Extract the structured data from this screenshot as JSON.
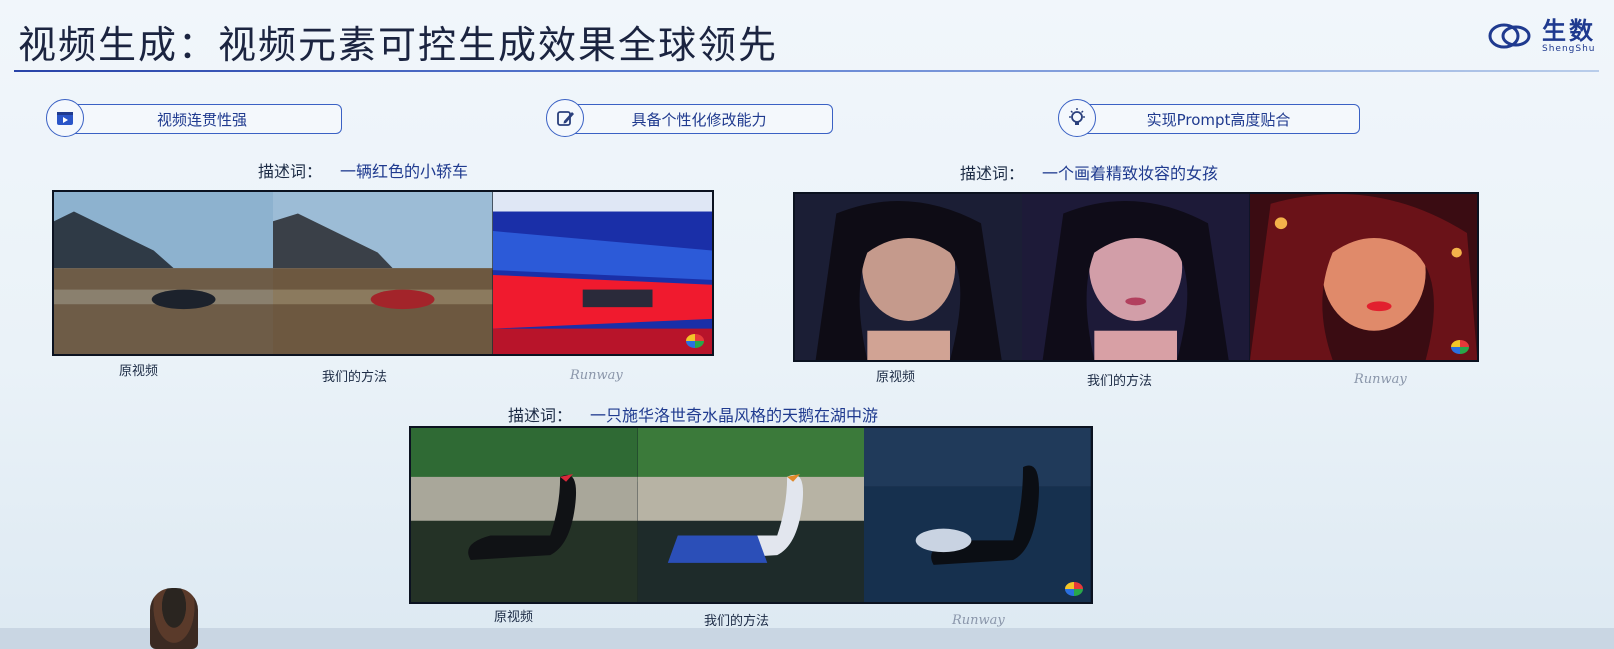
{
  "slide": {
    "title": "视频生成：视频元素可控生成效果全球领先",
    "logo_cn": "生数",
    "logo_en": "ShengShu"
  },
  "features": [
    {
      "label": "视频连贯性强",
      "icon": "video-player-icon"
    },
    {
      "label": "具备个性化修改能力",
      "icon": "edit-pencil-icon"
    },
    {
      "label": "实现Prompt高度贴合",
      "icon": "lightbulb-icon"
    }
  ],
  "groups": [
    {
      "prompt_label": "描述词：",
      "prompt_text": "一辆红色的小轿车",
      "captions": [
        "原视频",
        "我们的方法",
        "Runway"
      ]
    },
    {
      "prompt_label": "描述词：",
      "prompt_text": "一个画着精致妆容的女孩",
      "captions": [
        "原视频",
        "我们的方法",
        "Runway"
      ]
    },
    {
      "prompt_label": "描述词：",
      "prompt_text": "一只施华洛世奇水晶风格的天鹅在湖中游",
      "captions": [
        "原视频",
        "我们的方法",
        "Runway"
      ]
    }
  ],
  "colors": {
    "accent": "#1f3a8f",
    "rule": "#2943a8"
  }
}
